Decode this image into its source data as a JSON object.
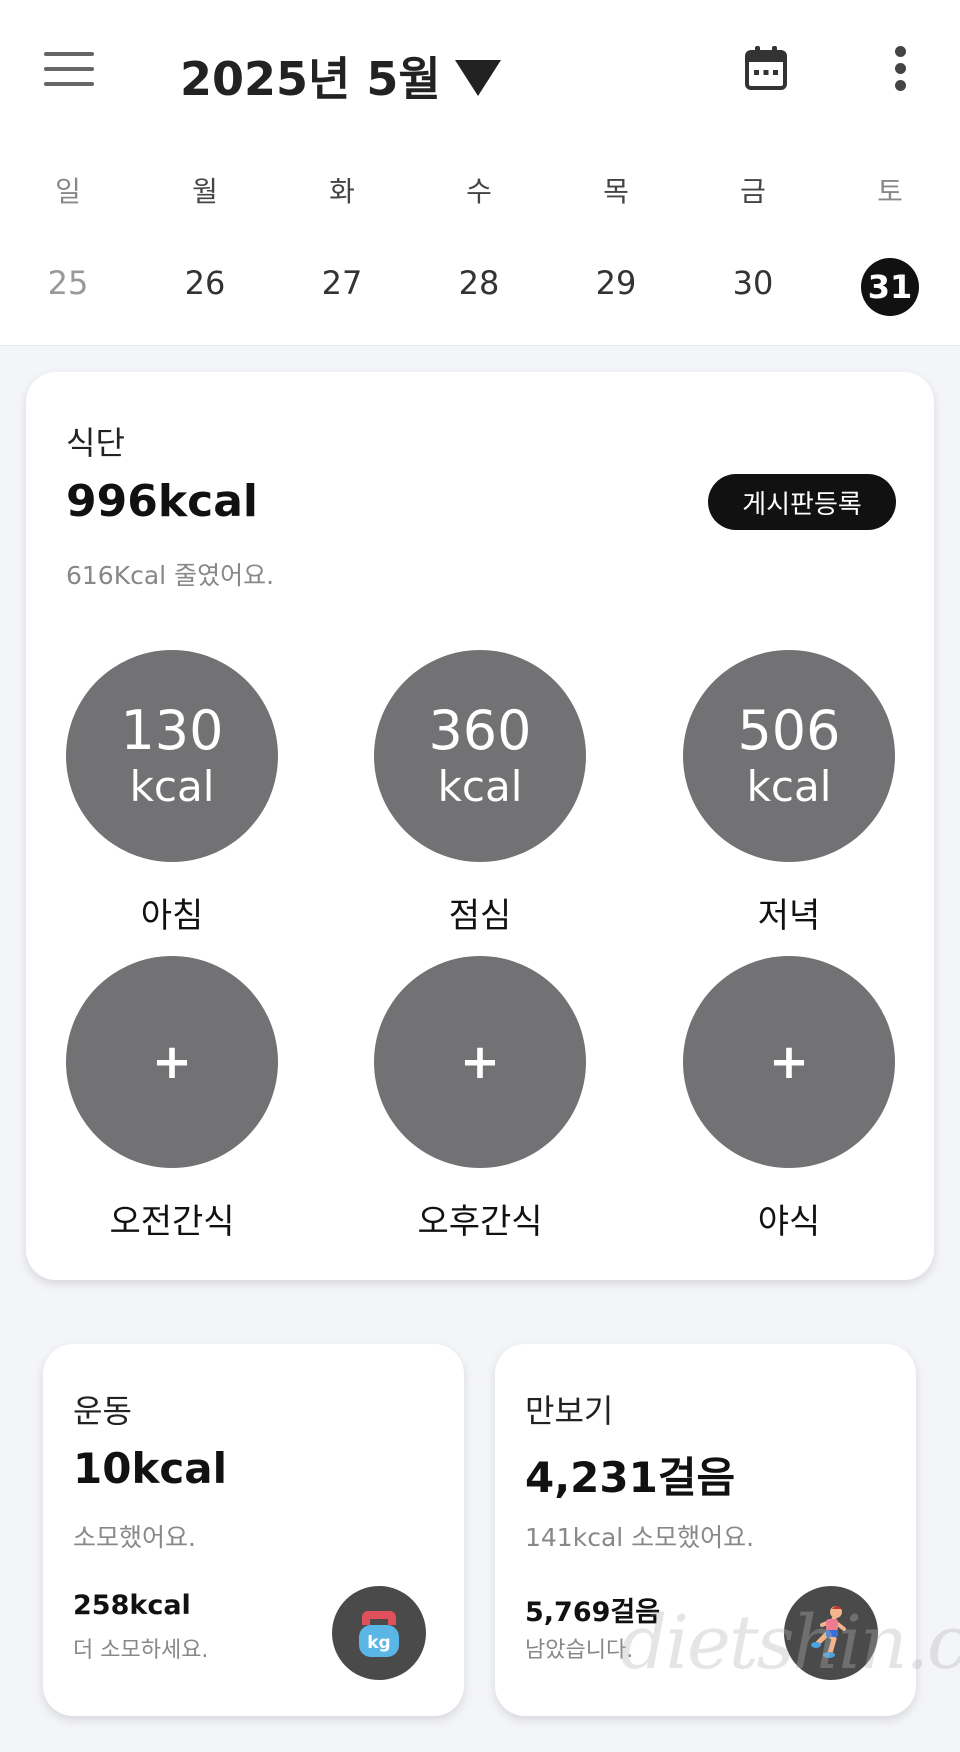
{
  "header": {
    "month_label": "2025년 5월"
  },
  "week": {
    "days": [
      "일",
      "월",
      "화",
      "수",
      "목",
      "금",
      "토"
    ],
    "dates": [
      "25",
      "26",
      "27",
      "28",
      "29",
      "30",
      "31"
    ],
    "selected_index": 6
  },
  "diet": {
    "label": "식단",
    "total": "996kcal",
    "board_button": "게시판등록",
    "note": "616Kcal 줄였어요.",
    "meals": [
      {
        "name": "아침",
        "kcal": "130",
        "unit": "kcal"
      },
      {
        "name": "점심",
        "kcal": "360",
        "unit": "kcal"
      },
      {
        "name": "저녁",
        "kcal": "506",
        "unit": "kcal"
      },
      {
        "name": "오전간식",
        "plus": "+"
      },
      {
        "name": "오후간식",
        "plus": "+"
      },
      {
        "name": "야식",
        "plus": "+"
      }
    ]
  },
  "exercise": {
    "label": "운동",
    "value": "10kcal",
    "note": "소모했어요.",
    "remaining_value": "258kcal",
    "remaining_note": "더 소모하세요.",
    "badge_text": "kg"
  },
  "steps": {
    "label": "만보기",
    "value": "4,231걸음",
    "note": "141kcal 소모했어요.",
    "remaining_value": "5,769걸음",
    "remaining_note": "남았습니다."
  },
  "watermark": "dietshin.com",
  "colors": {
    "circle": "#727173",
    "accent": "#111111",
    "background": "#f4f5f9"
  }
}
